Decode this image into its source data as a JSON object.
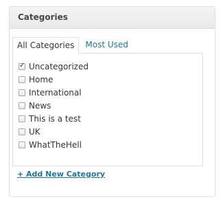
{
  "panel": {
    "title": "Categories"
  },
  "tabs": [
    {
      "label": "All Categories",
      "active": true
    },
    {
      "label": "Most Used",
      "active": false
    }
  ],
  "categories": [
    {
      "label": "Uncategorized",
      "checked": true
    },
    {
      "label": "Home",
      "checked": false
    },
    {
      "label": "International",
      "checked": false
    },
    {
      "label": "News",
      "checked": false
    },
    {
      "label": "This is a test",
      "checked": false
    },
    {
      "label": "UK",
      "checked": false
    },
    {
      "label": "WhatTheHell",
      "checked": false
    }
  ],
  "add_link": "+ Add New Category",
  "colors": {
    "link": "#21759b",
    "border": "#dfdfdf",
    "header_text": "#464646"
  }
}
